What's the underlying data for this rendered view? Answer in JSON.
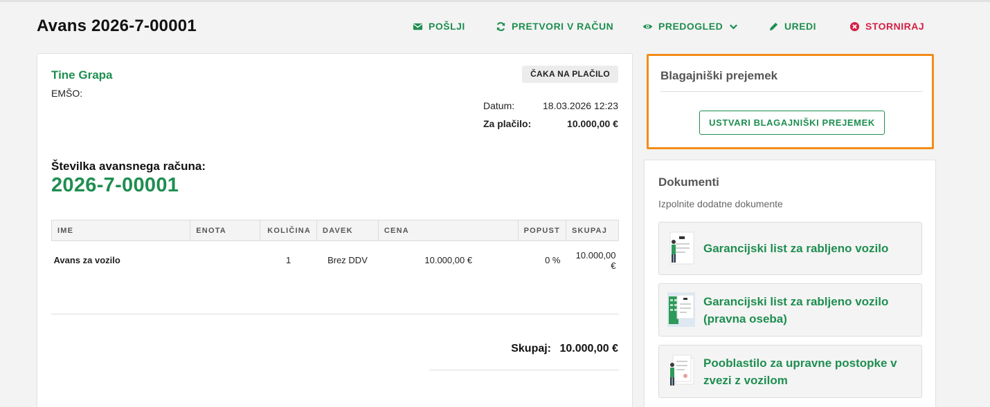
{
  "page": {
    "title": "Avans 2026-7-00001"
  },
  "toolbar": {
    "send_label": "POŠLJI",
    "convert_label": "PRETVORI V RAČUN",
    "preview_label": "PREDOGLED",
    "edit_label": "UREDI",
    "cancel_label": "STORNIRAJ"
  },
  "customer": {
    "name": "Tine Grapa",
    "emso_label": "EMŠO:"
  },
  "status": {
    "label": "ČAKA NA PLAČILO"
  },
  "meta": {
    "date_label": "Datum:",
    "date_value": "18.03.2026 12:23",
    "due_label": "Za plačilo:",
    "due_value": "10.000,00 €"
  },
  "invoice": {
    "number_label": "Številka avansnega računa:",
    "number": "2026-7-00001"
  },
  "table": {
    "headers": [
      "IME",
      "ENOTA",
      "KOLIČINA",
      "DAVEK",
      "CENA",
      "POPUST",
      "SKUPAJ"
    ],
    "rows": [
      {
        "name": "Avans za vozilo",
        "unit": "",
        "qty": "1",
        "tax": "Brez DDV",
        "price": "10.000,00 €",
        "discount": "0 %",
        "total": "10.000,00 €"
      }
    ]
  },
  "totals": {
    "label": "Skupaj:",
    "value": "10.000,00 €"
  },
  "cash": {
    "title": "Blagajniški prejemek",
    "button_label": "USTVARI BLAGAJNIŠKI PREJEMEK"
  },
  "documents": {
    "title": "Dokumenti",
    "subtitle": "Izpolnite dodatne dokumente",
    "items": [
      {
        "lines": [
          "Garancijski list za rabljeno vozilo"
        ]
      },
      {
        "lines": [
          "Garancijski list za rabljeno vozilo",
          "(pravna oseba)"
        ]
      },
      {
        "lines": [
          "Pooblastilo za upravne postopke v",
          "zvezi z vozilom"
        ]
      }
    ]
  },
  "colors": {
    "accent": "#1e8e50",
    "danger": "#d41f45",
    "highlight": "#f48c1a"
  }
}
